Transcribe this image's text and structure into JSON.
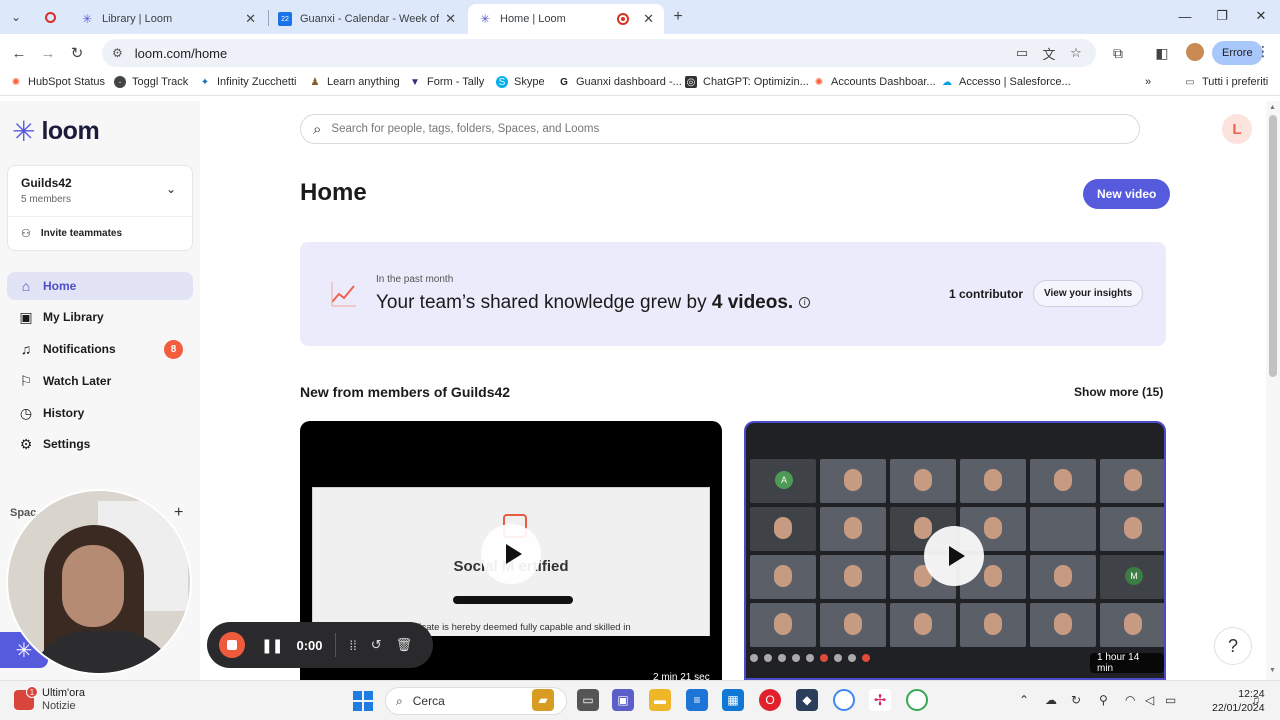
{
  "browser": {
    "tabs": [
      {
        "title": "Library | Loom"
      },
      {
        "title": "Guanxi - Calendar - Week of Fe"
      },
      {
        "title": "Home | Loom"
      }
    ],
    "url": "loom.com/home",
    "profile_button": "Errore"
  },
  "bookmarks": [
    {
      "label": "HubSpot Status"
    },
    {
      "label": "Toggl Track"
    },
    {
      "label": "Infinity Zucchetti"
    },
    {
      "label": "Learn anything"
    },
    {
      "label": "Form - Tally"
    },
    {
      "label": "Skype"
    },
    {
      "label": "Guanxi dashboard -..."
    },
    {
      "label": "ChatGPT: Optimizin..."
    },
    {
      "label": "Accounts Dashboar..."
    },
    {
      "label": "Accesso | Salesforce..."
    }
  ],
  "bookmarks_folder": "Tutti i preferiti",
  "sidebar": {
    "workspace_name": "Guilds42",
    "workspace_members": "5 members",
    "invite_label": "Invite teammates",
    "items": [
      {
        "label": "Home"
      },
      {
        "label": "My Library"
      },
      {
        "label": "Notifications",
        "badge": "8"
      },
      {
        "label": "Watch Later"
      },
      {
        "label": "History"
      },
      {
        "label": "Settings"
      }
    ],
    "spaces_label": "Spac"
  },
  "main": {
    "search_placeholder": "Search for people, tags, folders, Spaces, and Looms",
    "avatar_initial": "L",
    "title": "Home",
    "new_video_label": "New video",
    "insights": {
      "period": "In the past month",
      "headline_prefix": "Your team’s shared knowledge grew by ",
      "headline_value": "4 videos.",
      "contributors": "1 contributor",
      "view_button": "View your insights"
    },
    "section_title": "New from members of Guilds42",
    "show_more": "Show more (15)",
    "videos": [
      {
        "duration": "2 min 21 sec",
        "cert_title": "Social M   ertified",
        "cert_text": "s certificate is hereby deemed fully capable and skilled in"
      },
      {
        "duration": "1 hour 14 min",
        "tile_initials": [
          "A",
          "M"
        ]
      }
    ]
  },
  "recorder": {
    "time": "0:00"
  },
  "taskbar": {
    "news_title": "Ultim'ora",
    "news_subtitle": "Notizie",
    "news_badge": "1",
    "search_label": "Cerca",
    "time": "12:24",
    "date": "22/01/2024"
  },
  "colors": {
    "accent": "#565add",
    "badge": "#f45d3e",
    "record": "#f05a3c"
  }
}
